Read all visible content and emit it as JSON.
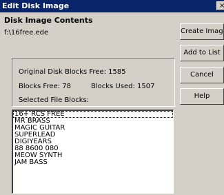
{
  "window": {
    "title": "Edit Disk Image",
    "close_glyph": "×"
  },
  "contents": {
    "header": "Disk Image Contents",
    "path": "f:\\16free.ede"
  },
  "info": {
    "original_free": "Original Disk Blocks Free: 1585",
    "blocks_free": "Blocks Free: 78",
    "blocks_used": "Blocks Used: 1507",
    "selected": "Selected File Blocks:"
  },
  "files": [
    "16+ RCS FREE",
    "MR BRASS",
    "MAGIC GUITAR",
    "SUPERLEAD",
    "DIGIYEARS",
    "88 8600 080",
    "MEOW SYNTH",
    "JAM BASS"
  ],
  "buttons": {
    "create": "Create Image",
    "add": "Add to List",
    "cancel": "Cancel",
    "help": "Help"
  }
}
